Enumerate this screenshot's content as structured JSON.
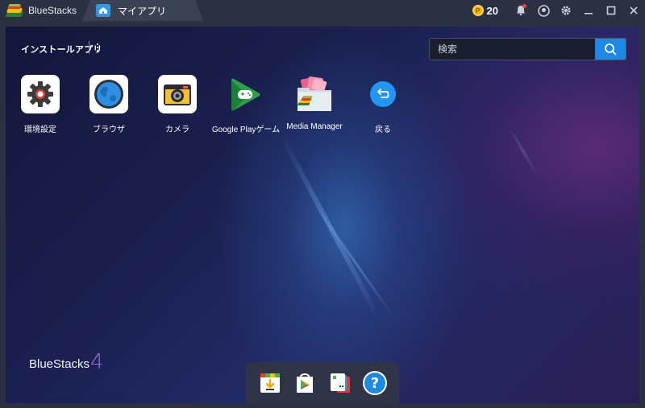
{
  "window": {
    "brand_tab": "BlueStacks",
    "active_tab": "マイアプリ"
  },
  "toolbar": {
    "coin_count": "20",
    "icons": [
      "coin-icon",
      "bell-icon",
      "account-icon",
      "gear-icon",
      "minimize-icon",
      "maximize-icon",
      "close-icon"
    ],
    "notification_dot_color": "#ff3b30"
  },
  "main": {
    "section_title": "インストールアプリ",
    "search": {
      "placeholder": "検索",
      "value": ""
    },
    "apps": [
      {
        "label": "環境設定",
        "icon": "settings-gear-icon"
      },
      {
        "label": "ブラウザ",
        "icon": "globe-icon"
      },
      {
        "label": "カメラ",
        "icon": "camera-icon"
      },
      {
        "label": "Google Playゲーム",
        "icon": "gamepad-icon"
      },
      {
        "label": "Media Manager",
        "icon": "media-folder-icon"
      },
      {
        "label": "戻る",
        "icon": "back-arrow-icon"
      }
    ],
    "brand_logo_text": "BlueStacks",
    "brand_version": "4"
  },
  "dock": {
    "items": [
      "app-center-icon",
      "play-store-icon",
      "multi-instance-icon",
      "help-icon"
    ],
    "help_glyph": "?"
  },
  "colors": {
    "accent": "#1e88e5",
    "titlebar": "#2b3142",
    "version_purple": "#9c6ae0"
  }
}
